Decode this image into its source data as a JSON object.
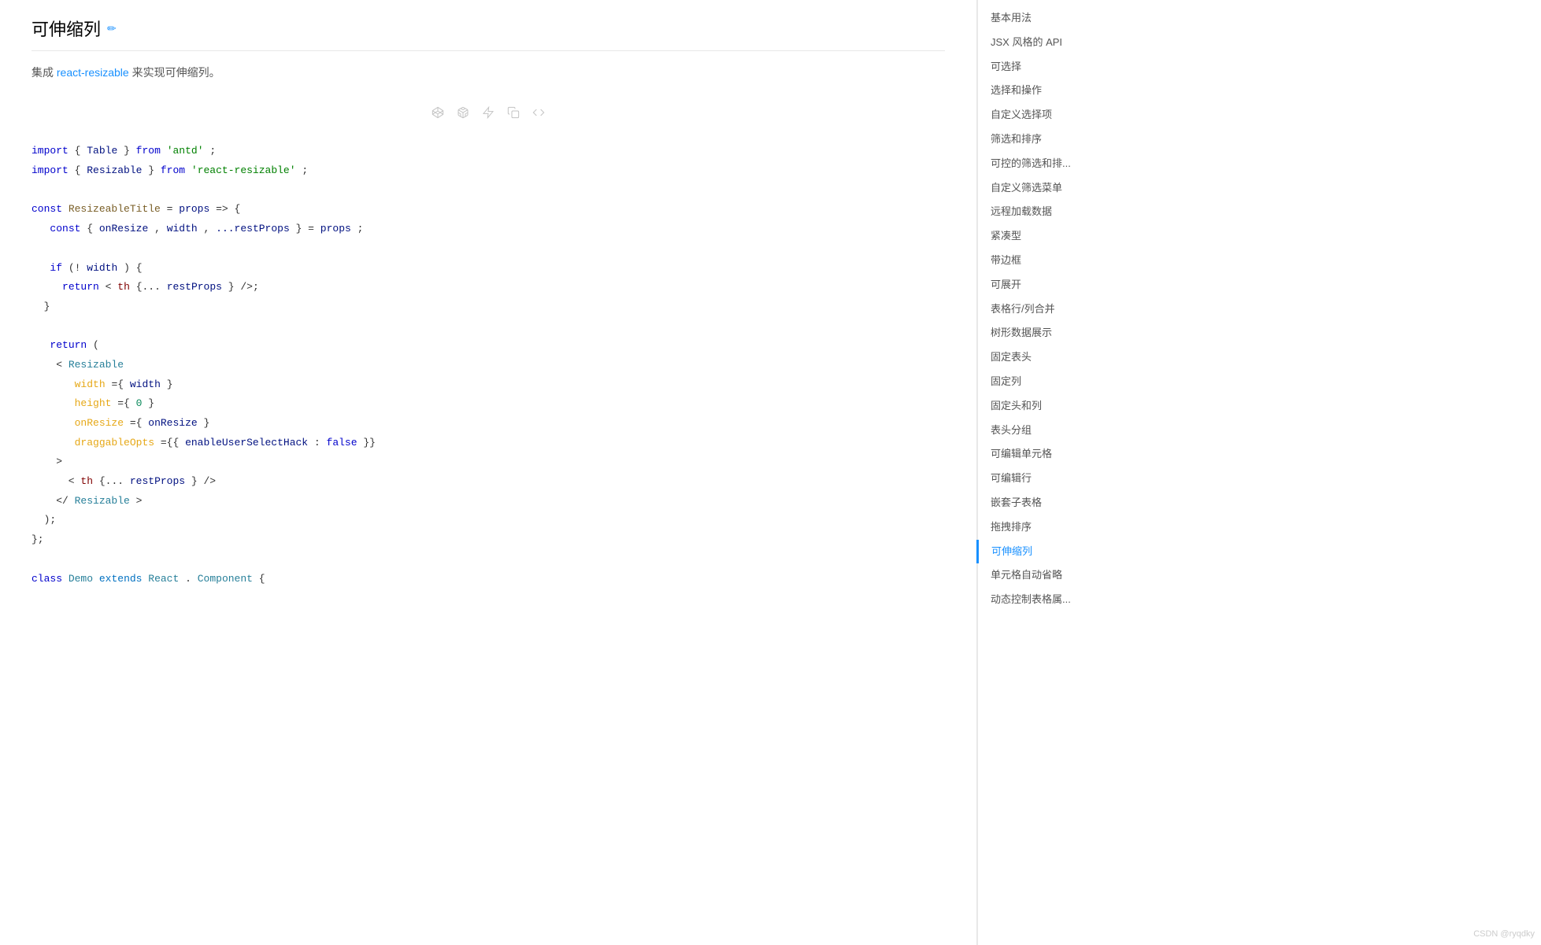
{
  "page": {
    "title": "可伸缩列",
    "edit_icon": "✏",
    "description_prefix": "集成",
    "description_link": "react-resizable",
    "description_suffix": " 来实现可伸缩列。"
  },
  "toolbar": {
    "icons": [
      {
        "name": "codepen-icon",
        "symbol": "◈"
      },
      {
        "name": "codesandbox-icon",
        "symbol": "⬡"
      },
      {
        "name": "stackblitz-icon",
        "symbol": "⚡"
      },
      {
        "name": "copy-icon",
        "symbol": "⧉"
      },
      {
        "name": "code-toggle-icon",
        "symbol": "</>"
      }
    ]
  },
  "sidebar": {
    "items": [
      {
        "label": "基本用法",
        "active": false
      },
      {
        "label": "JSX 风格的 API",
        "active": false
      },
      {
        "label": "可选择",
        "active": false
      },
      {
        "label": "选择和操作",
        "active": false
      },
      {
        "label": "自定义选择项",
        "active": false
      },
      {
        "label": "筛选和排序",
        "active": false
      },
      {
        "label": "可控的筛选和排...",
        "active": false
      },
      {
        "label": "自定义筛选菜单",
        "active": false
      },
      {
        "label": "远程加载数据",
        "active": false
      },
      {
        "label": "紧凑型",
        "active": false
      },
      {
        "label": "带边框",
        "active": false
      },
      {
        "label": "可展开",
        "active": false
      },
      {
        "label": "表格行/列合并",
        "active": false
      },
      {
        "label": "树形数据展示",
        "active": false
      },
      {
        "label": "固定表头",
        "active": false
      },
      {
        "label": "固定列",
        "active": false
      },
      {
        "label": "固定头和列",
        "active": false
      },
      {
        "label": "表头分组",
        "active": false
      },
      {
        "label": "可编辑单元格",
        "active": false
      },
      {
        "label": "可编辑行",
        "active": false
      },
      {
        "label": "嵌套子表格",
        "active": false
      },
      {
        "label": "拖拽排序",
        "active": false
      },
      {
        "label": "可伸缩列",
        "active": true
      },
      {
        "label": "单元格自动省略",
        "active": false
      },
      {
        "label": "动态控制表格属...",
        "active": false
      }
    ]
  },
  "footer": {
    "watermark": "CSDN @ryqdky"
  }
}
